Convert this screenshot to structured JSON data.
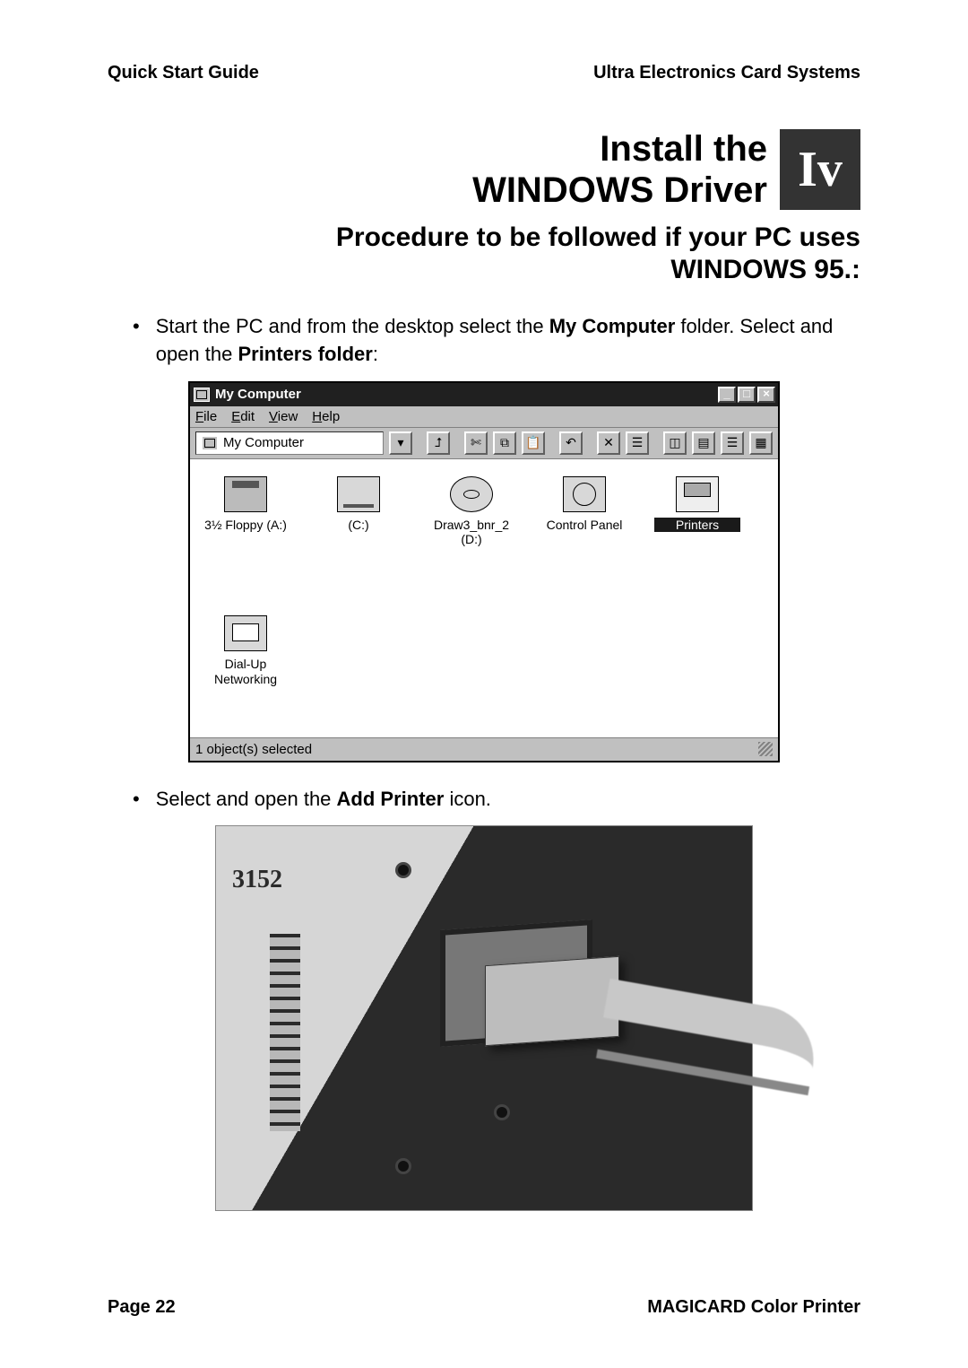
{
  "header": {
    "left": "Quick Start Guide",
    "right": "Ultra Electronics Card Systems"
  },
  "title": {
    "line1": "Install the",
    "line2": "WINDOWS Driver",
    "step": "Iv"
  },
  "subtitle": {
    "line1": "Procedure to be followed if your PC uses",
    "line2": "WINDOWS 95.:"
  },
  "bullets": {
    "b1_pre": "Start the PC and from the desktop select the ",
    "b1_bold1": "My Computer",
    "b1_mid": " folder. Select and open the ",
    "b1_bold2": "Printers folder",
    "b1_post": ":",
    "b2_pre": "Select and open the ",
    "b2_bold": "Add Printer",
    "b2_post": " icon."
  },
  "win95": {
    "title": "My Computer",
    "btn_min": "_",
    "btn_max": "□",
    "btn_close": "×",
    "menu": {
      "file": "File",
      "edit": "Edit",
      "view": "View",
      "help": "Help"
    },
    "address": "My Computer",
    "icons": {
      "floppy": "3½ Floppy (A:)",
      "c": "(C:)",
      "d": "Draw3_bnr_2 (D:)",
      "cpanel": "Control Panel",
      "printers": "Printers",
      "dun": "Dial-Up Networking"
    },
    "status": "1 object(s) selected"
  },
  "photo": {
    "case_label": "3152"
  },
  "footer": {
    "left": "Page 22",
    "right": "MAGICARD Color Printer"
  }
}
